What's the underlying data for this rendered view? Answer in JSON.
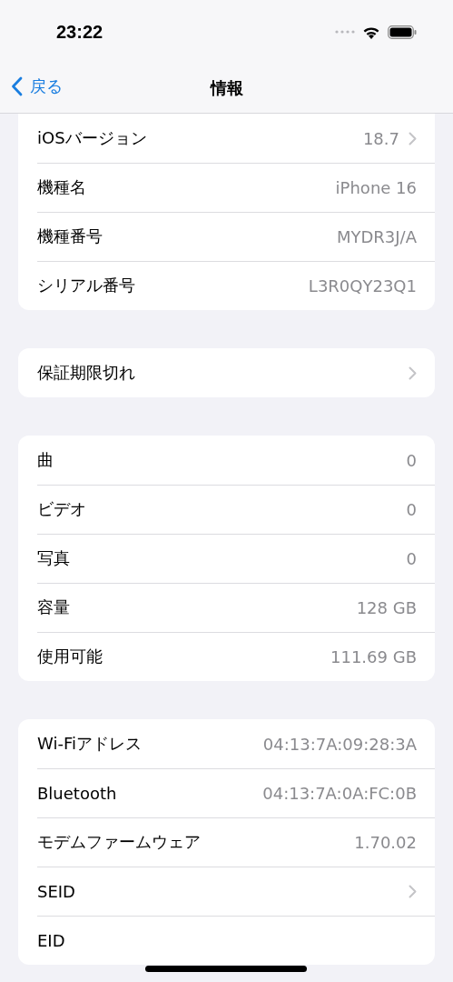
{
  "status_bar": {
    "time": "23:22"
  },
  "nav": {
    "back": "戻る",
    "title": "情報"
  },
  "groups": [
    {
      "top_cut": true,
      "rows": [
        {
          "label": "iOSバージョン",
          "value": "18.7",
          "chevron": true
        },
        {
          "label": "機種名",
          "value": "iPhone 16",
          "chevron": false
        },
        {
          "label": "機種番号",
          "value": "MYDR3J/A",
          "chevron": false
        },
        {
          "label": "シリアル番号",
          "value": "L3R0QY23Q1",
          "chevron": false
        }
      ]
    },
    {
      "top_cut": false,
      "rows": [
        {
          "label": "保証期限切れ",
          "chevron": true
        }
      ]
    },
    {
      "top_cut": false,
      "rows": [
        {
          "label": "曲",
          "value": "0",
          "chevron": false
        },
        {
          "label": "ビデオ",
          "value": "0",
          "chevron": false
        },
        {
          "label": "写真",
          "value": "0",
          "chevron": false
        },
        {
          "label": "容量",
          "value": "128 GB",
          "chevron": false
        },
        {
          "label": "使用可能",
          "value": "111.69 GB",
          "chevron": false
        }
      ]
    },
    {
      "top_cut": false,
      "rows": [
        {
          "label": "Wi-Fiアドレス",
          "value": "04:13:7A:09:28:3A",
          "chevron": false
        },
        {
          "label": "Bluetooth",
          "value": "04:13:7A:0A:FC:0B",
          "chevron": false
        },
        {
          "label": "モデムファームウェア",
          "value": "1.70.02",
          "chevron": false
        },
        {
          "label": "SEID",
          "chevron": true
        },
        {
          "label": "EID",
          "chevron": false
        }
      ]
    }
  ]
}
